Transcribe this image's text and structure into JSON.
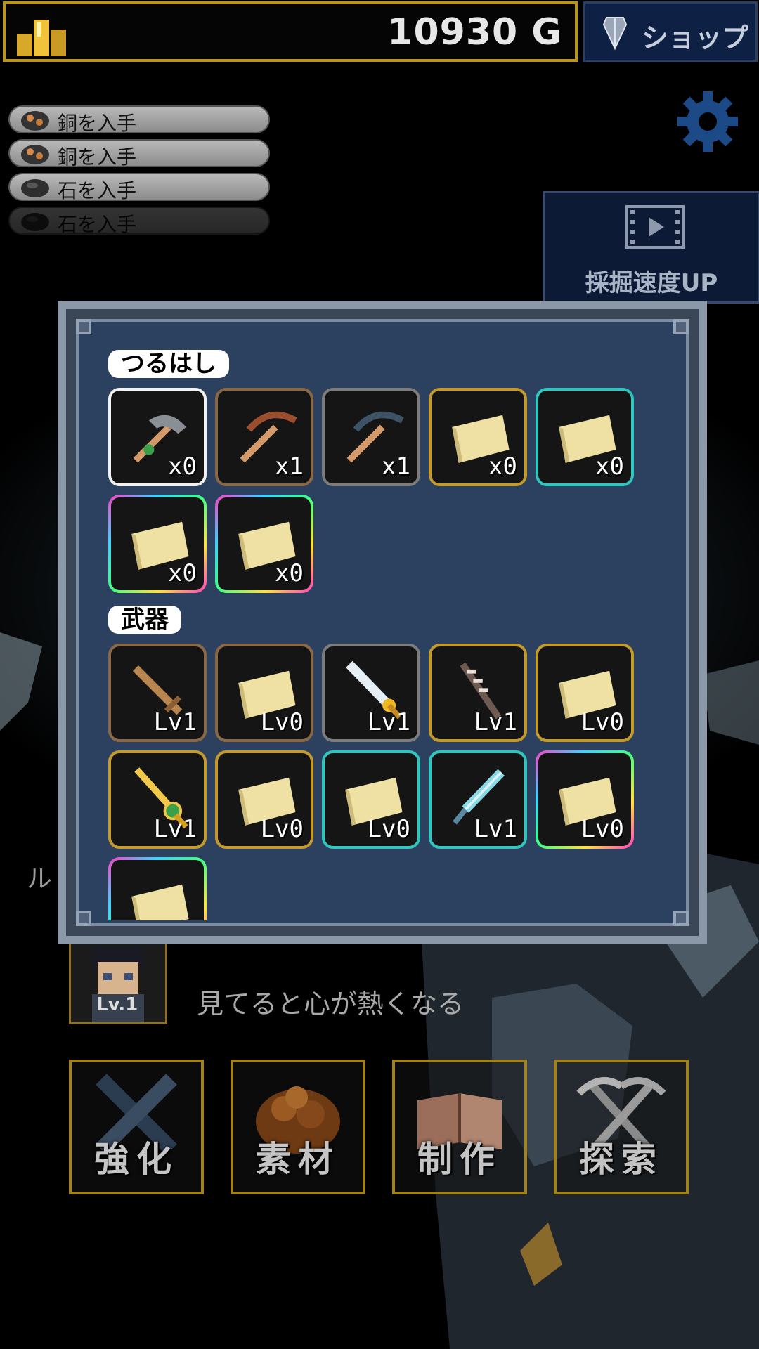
{
  "header": {
    "gold_amount": "10930 G",
    "shop_label": "ショップ"
  },
  "log": {
    "entries": [
      {
        "text": "銅を入手",
        "icon": "copper-ore-icon"
      },
      {
        "text": "銅を入手",
        "icon": "copper-ore-icon"
      },
      {
        "text": "石を入手",
        "icon": "stone-icon"
      },
      {
        "text": "石を入手",
        "icon": "stone-icon"
      }
    ]
  },
  "ad": {
    "label": "採掘速度UP"
  },
  "popup": {
    "sections": [
      {
        "label": "つるはし",
        "items": [
          {
            "rarity": "white",
            "icon": "stone-pickaxe-icon",
            "count": "x0"
          },
          {
            "rarity": "bronze",
            "icon": "copper-pickaxe-icon",
            "count": "x1"
          },
          {
            "rarity": "silver",
            "icon": "iron-pickaxe-icon",
            "count": "x1"
          },
          {
            "rarity": "gold",
            "icon": "unknown-scroll-icon",
            "count": "x0"
          },
          {
            "rarity": "cyan",
            "icon": "unknown-scroll-icon",
            "count": "x0"
          },
          {
            "rarity": "rainbow",
            "icon": "unknown-scroll-icon",
            "count": "x0"
          },
          {
            "rarity": "rainbow",
            "icon": "unknown-scroll-icon",
            "count": "x0"
          }
        ]
      },
      {
        "label": "武器",
        "items": [
          {
            "rarity": "bronze",
            "icon": "wooden-sword-icon",
            "count": "Lv1"
          },
          {
            "rarity": "bronze",
            "icon": "unknown-scroll-icon",
            "count": "Lv0"
          },
          {
            "rarity": "silver",
            "icon": "silver-sword-icon",
            "count": "Lv1"
          },
          {
            "rarity": "gold",
            "icon": "bone-spear-icon",
            "count": "Lv1"
          },
          {
            "rarity": "gold",
            "icon": "unknown-scroll-icon",
            "count": "Lv0"
          },
          {
            "rarity": "gold",
            "icon": "golden-sword-icon",
            "count": "Lv1"
          },
          {
            "rarity": "gold",
            "icon": "unknown-scroll-icon",
            "count": "Lv0"
          },
          {
            "rarity": "cyan",
            "icon": "unknown-scroll-icon",
            "count": "Lv0"
          },
          {
            "rarity": "cyan",
            "icon": "crystal-sword-icon",
            "count": "Lv1"
          },
          {
            "rarity": "rainbow",
            "icon": "unknown-scroll-icon",
            "count": "Lv0"
          },
          {
            "rarity": "rainbow",
            "icon": "unknown-scroll-icon",
            "count": ""
          }
        ]
      }
    ]
  },
  "character": {
    "level": "Lv.1",
    "quote": "見てると心が熱くなる",
    "side_text": "ル"
  },
  "menu": [
    {
      "label": "強化",
      "icon": "crossed-swords-icon"
    },
    {
      "label": "素材",
      "icon": "ore-pile-icon"
    },
    {
      "label": "制作",
      "icon": "open-book-icon"
    },
    {
      "label": "探索",
      "icon": "crossed-pickaxes-icon"
    }
  ],
  "colors": {
    "gold_border": "#b8961e",
    "popup_bg": "#2c4060",
    "shop_bg": "#0e2144"
  }
}
